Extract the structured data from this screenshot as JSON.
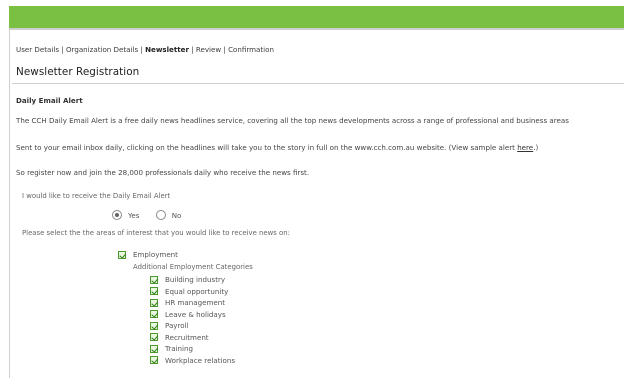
{
  "breadcrumbs": [
    "User Details",
    "Organization Details",
    "Newsletter",
    "Review",
    "Confirmation"
  ],
  "breadcrumb_separator": "|",
  "page_title": "Newsletter Registration",
  "section_heading": "Daily Email Alert",
  "paragraphs": {
    "intro": "The CCH Daily Email Alert is a free daily news headlines service, covering all the top news developments across a range of professional and business areas",
    "sent_before_link": "Sent to your email inbox daily, clicking on the headlines will take you to the story in full on the www.cch.com.au website. (View sample alert ",
    "sent_link": "here",
    "sent_after_link": ".)",
    "register": "So register now and join the 28,000 professionals daily who receive the news first."
  },
  "question": "I would like to receive the Daily Email Alert",
  "radio_options": [
    {
      "label": "Yes",
      "selected": true
    },
    {
      "label": "No",
      "selected": false
    }
  ],
  "areas_question": "Please select the the areas of interest that you would like to receive news on:",
  "main_category": {
    "label": "Employment",
    "checked": true
  },
  "additional_label": "Additional Employment Categories",
  "sub_categories": [
    {
      "label": "Building industry",
      "checked": true
    },
    {
      "label": "Equal opportunity",
      "checked": true
    },
    {
      "label": "HR management",
      "checked": true
    },
    {
      "label": "Leave & holidays",
      "checked": true
    },
    {
      "label": "Payroll",
      "checked": true
    },
    {
      "label": "Recruitment",
      "checked": true
    },
    {
      "label": "Training",
      "checked": true
    },
    {
      "label": "Workplace relations",
      "checked": true
    }
  ],
  "colors": {
    "header_bar": "#7ac143",
    "checkbox_border": "#4b9a2b"
  }
}
